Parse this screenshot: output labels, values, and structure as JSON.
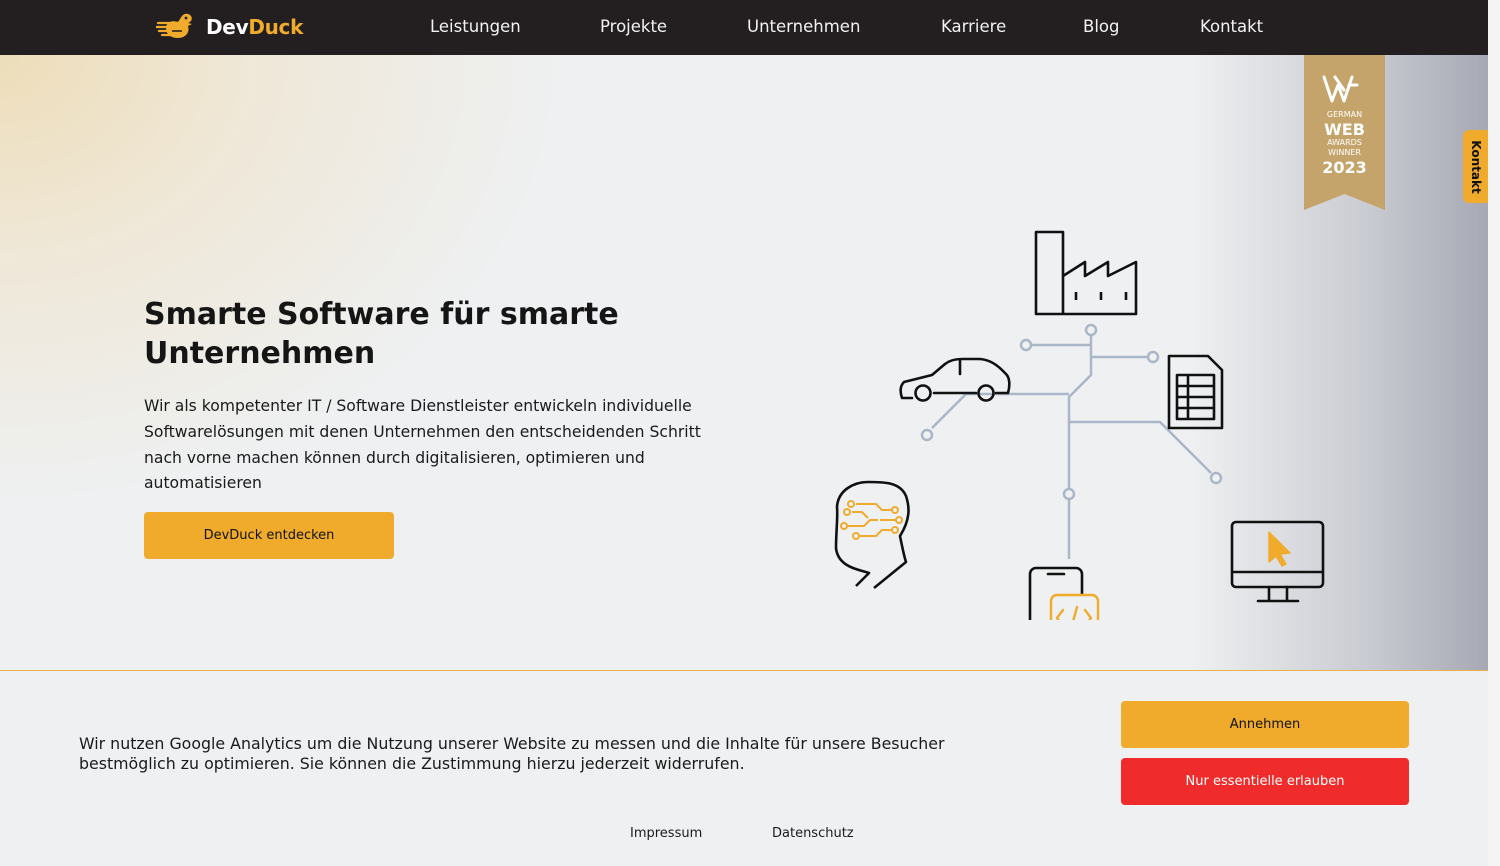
{
  "brand": {
    "name_part1": "Dev",
    "name_part2": "Duck",
    "accent": "#f0ab2c",
    "nav_bg": "#231f20"
  },
  "nav": {
    "items": [
      {
        "label": "Leistungen"
      },
      {
        "label": "Projekte"
      },
      {
        "label": "Unternehmen"
      },
      {
        "label": "Karriere"
      },
      {
        "label": "Blog"
      },
      {
        "label": "Kontakt"
      }
    ]
  },
  "hero": {
    "title": "Smarte Software für smarte Unternehmen",
    "text": "Wir als kompetenter IT / Software Dienstleister entwickeln individuelle Softwarelösungen mit denen Unternehmen den entscheidenden Schritt nach vorne machen können durch digitalisieren, optimieren und automatisieren",
    "cta_label": "DevDuck entdecken",
    "illustration_icons": [
      "car-icon",
      "factory-icon",
      "spreadsheet-icon",
      "ai-head-icon",
      "smartphone-code-icon",
      "monitor-cursor-icon"
    ]
  },
  "award": {
    "line1": "GERMAN",
    "line2": "WEB",
    "line3": "AWARDS",
    "line4": "WINNER",
    "year": "2023",
    "color": "#c4a46a"
  },
  "side_tab": {
    "label": "Kontakt"
  },
  "cookie": {
    "text": "Wir nutzen Google Analytics um die Nutzung unserer Website zu messen und die Inhalte für unsere Besucher bestmöglich zu optimieren. Sie können die Zustimmung hierzu jederzeit widerrufen.",
    "accept_label": "Annehmen",
    "essential_label": "Nur essentielle erlauben",
    "essential_color": "#ef2b2b"
  },
  "footer": {
    "imprint": "Impressum",
    "privacy": "Datenschutz"
  }
}
